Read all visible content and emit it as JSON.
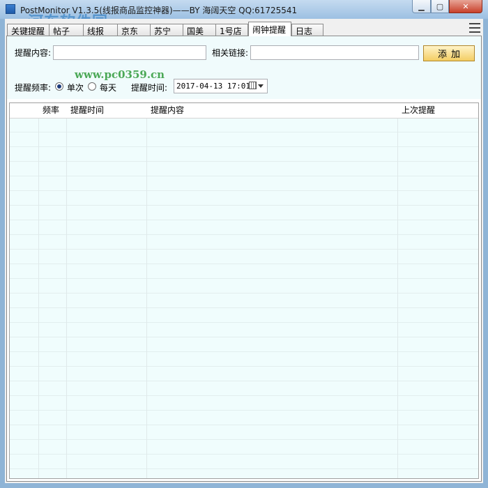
{
  "window": {
    "title": "PostMonitor V1.3.5(线报商品监控神器)——BY 海阔天空 QQ:61725541",
    "buttons": {
      "minimize": "▁",
      "maximize": "▢",
      "close": "✕"
    }
  },
  "watermark": {
    "text": "河东软件园",
    "url": "www.pc0359.cn"
  },
  "tabs": [
    {
      "label": "关键提醒"
    },
    {
      "label": "帖子"
    },
    {
      "label": "线报"
    },
    {
      "label": "京东"
    },
    {
      "label": "苏宁"
    },
    {
      "label": "国美"
    },
    {
      "label": "1号店"
    },
    {
      "label": "闹钟提醒",
      "active": true
    },
    {
      "label": "日志"
    }
  ],
  "form": {
    "content_label": "提醒内容:",
    "content_value": "",
    "link_label": "相关链接:",
    "link_value": "",
    "add_button": "添加",
    "freq_label": "提醒频率:",
    "freq_options": [
      {
        "label": "单次",
        "selected": true
      },
      {
        "label": "每天",
        "selected": false
      }
    ],
    "time_label": "提醒时间:",
    "time_value": "2017-04-13 17:01"
  },
  "table": {
    "columns": [
      "",
      "频率",
      "提醒时间",
      "提醒内容",
      "上次提醒"
    ],
    "rows": []
  },
  "colors": {
    "form_bg": "#f0fbfc",
    "grid_bg": "#f0fdfd",
    "add_button": "#f3cd63"
  }
}
